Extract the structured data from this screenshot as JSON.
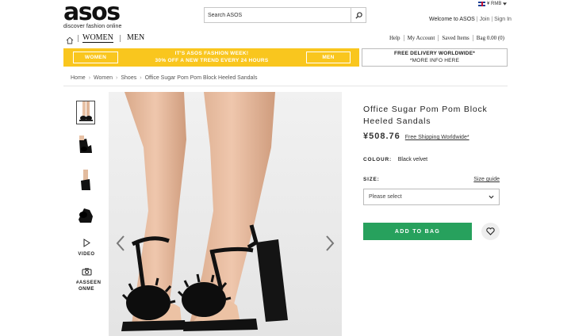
{
  "logo": {
    "word": "asos",
    "tagline": "discover fashion online"
  },
  "search": {
    "placeholder": "Search ASOS"
  },
  "currency": {
    "label": "¥ RMB"
  },
  "account": {
    "welcome": "Welcome to ASOS",
    "join": "Join",
    "sign_in": "Sign In"
  },
  "nav": {
    "tabs": [
      {
        "label": "WOMEN",
        "active": true
      },
      {
        "label": "MEN",
        "active": false
      }
    ],
    "links": [
      "Help",
      "My Account",
      "Saved Items",
      "Bag 0.00 (0)"
    ]
  },
  "promo": {
    "left_button": "WOMEN",
    "line1": "IT'S ASOS FASHION WEEK!",
    "line2": "30% OFF A NEW TREND EVERY 24 HOURS",
    "right_button": "MEN"
  },
  "delivery": {
    "line1": "FREE DELIVERY WORLDWIDE*",
    "line2": "*MORE INFO HERE"
  },
  "breadcrumb": [
    "Home",
    "Women",
    "Shoes",
    "Office Sugar Pom Pom Block Heeled Sandals"
  ],
  "gallery": {
    "thumbnail_count": 4,
    "selected_index": 0,
    "video_label": "VIDEO",
    "asseen_line1": "#ASSEEN",
    "asseen_line2": "ONME"
  },
  "product": {
    "title": "Office Sugar Pom Pom Block Heeled Sandals",
    "price": "¥508.76",
    "shipping": "Free Shipping Worldwide*",
    "colour_label": "COLOUR:",
    "colour_value": "Black velvet",
    "size_label": "SIZE:",
    "size_guide": "Size guide",
    "size_select": "Please select",
    "add_to_bag": "ADD TO BAG"
  },
  "colors": {
    "promo": "#f9c61e",
    "add_to_bag": "#27a15d"
  }
}
